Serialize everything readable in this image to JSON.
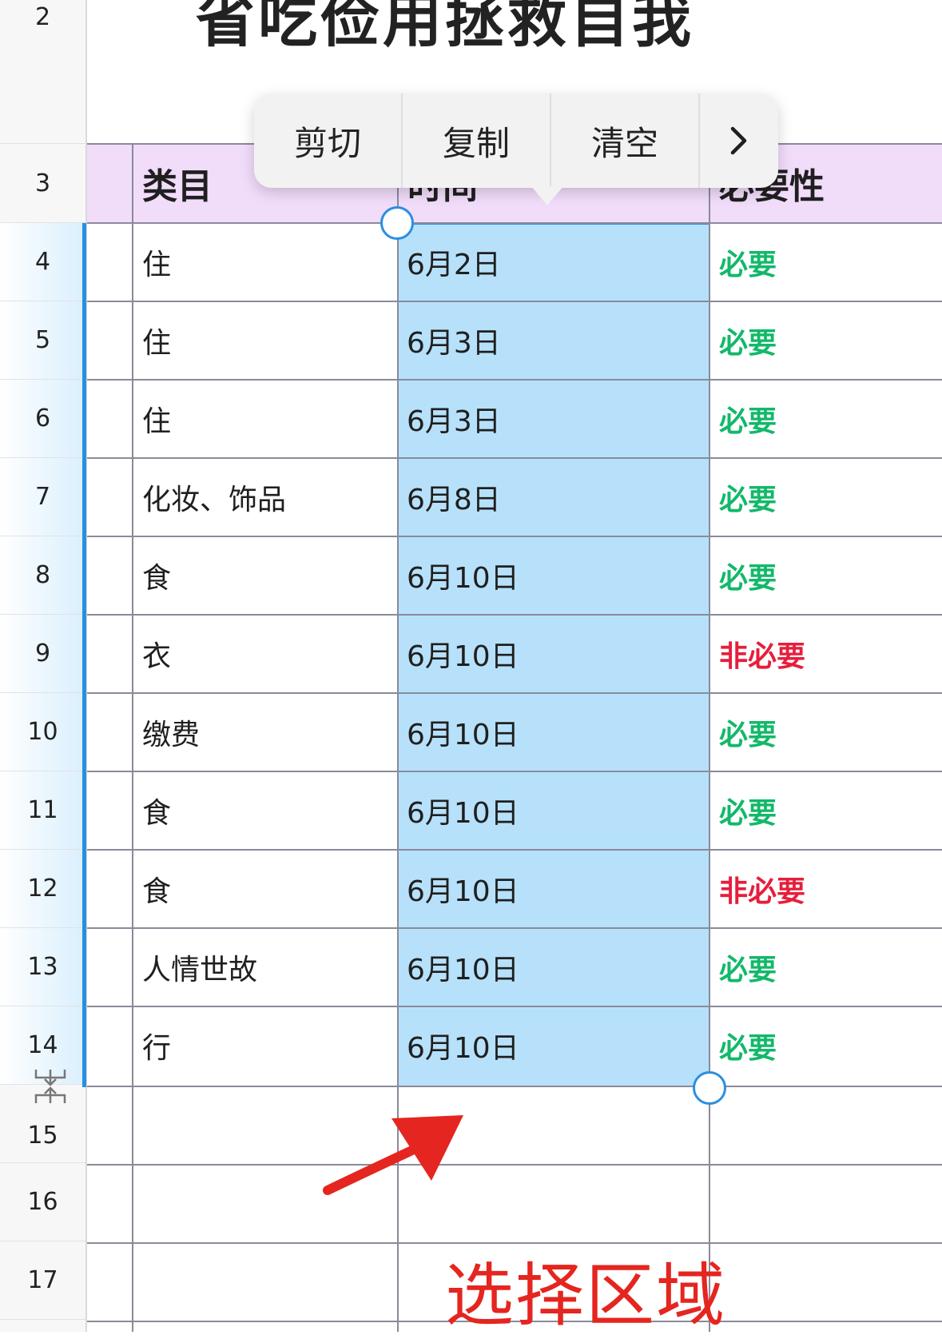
{
  "sheet_title": "省吃俭用拯救自我",
  "context_menu": {
    "items": [
      "剪切",
      "复制",
      "清空"
    ],
    "more_icon": "chevron-right-icon"
  },
  "columns": {
    "category": "类目",
    "time": "时间",
    "necessity": "必要性"
  },
  "row_numbers": [
    "2",
    "3",
    "4",
    "5",
    "6",
    "7",
    "8",
    "9",
    "10",
    "11",
    "12",
    "13",
    "14",
    "15",
    "16",
    "17"
  ],
  "rows": [
    {
      "category": "住",
      "time": "6月2日",
      "necessity": "必要"
    },
    {
      "category": "住",
      "time": "6月3日",
      "necessity": "必要"
    },
    {
      "category": "住",
      "time": "6月3日",
      "necessity": "必要"
    },
    {
      "category": "化妆、饰品",
      "time": "6月8日",
      "necessity": "必要"
    },
    {
      "category": "食",
      "time": "6月10日",
      "necessity": "必要"
    },
    {
      "category": "衣",
      "time": "6月10日",
      "necessity": "非必要"
    },
    {
      "category": "缴费",
      "time": "6月10日",
      "necessity": "必要"
    },
    {
      "category": "食",
      "time": "6月10日",
      "necessity": "必要"
    },
    {
      "category": "食",
      "time": "6月10日",
      "necessity": "非必要"
    },
    {
      "category": "人情世故",
      "time": "6月10日",
      "necessity": "必要"
    },
    {
      "category": "行",
      "time": "6月10日",
      "necessity": "必要"
    }
  ],
  "annotation": "选择区域",
  "colors": {
    "selection": "#b7e1fa",
    "selection_border": "#2a8fe0",
    "header_band": "#f1dcfa",
    "necessary": "#13b86a",
    "unnecessary": "#e61e3c",
    "annotation": "#e5251f"
  }
}
